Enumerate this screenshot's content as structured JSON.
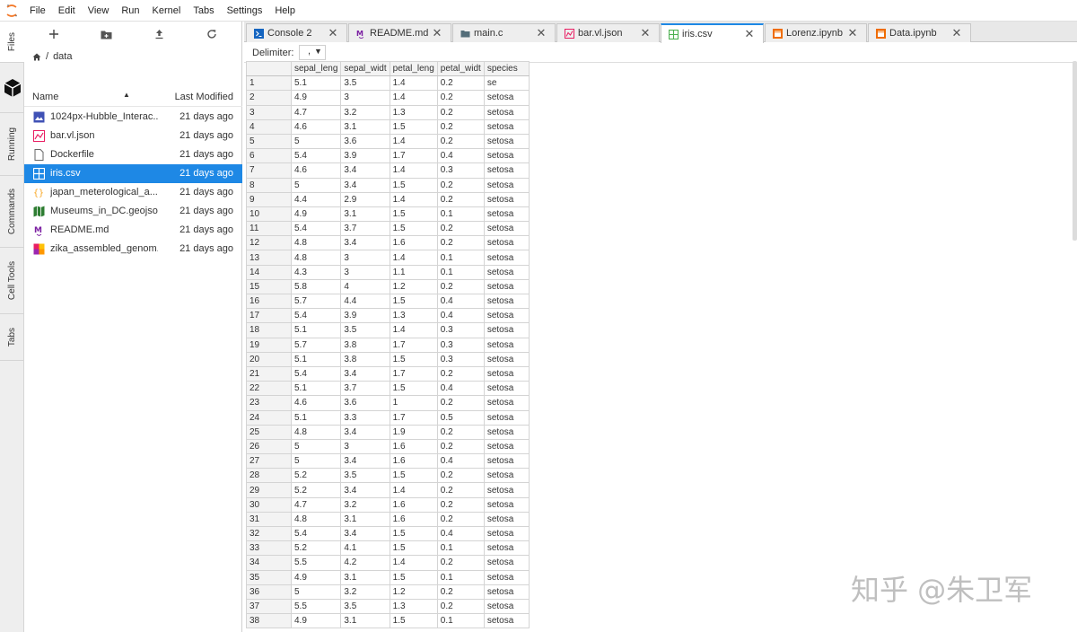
{
  "menubar": {
    "items": [
      "File",
      "Edit",
      "View",
      "Run",
      "Kernel",
      "Tabs",
      "Settings",
      "Help"
    ]
  },
  "sidetabs": {
    "files": "Files",
    "running": "Running",
    "commands": "Commands",
    "cell_tools": "Cell Tools",
    "tabs": "Tabs"
  },
  "filebrowser": {
    "breadcrumb": "data",
    "col_name": "Name",
    "col_modified": "Last Modified",
    "files": [
      {
        "name": "1024px-Hubble_Interac...",
        "modified": "21 days ago",
        "icon": "image-icon"
      },
      {
        "name": "bar.vl.json",
        "modified": "21 days ago",
        "icon": "vega-icon"
      },
      {
        "name": "Dockerfile",
        "modified": "21 days ago",
        "icon": "file-icon"
      },
      {
        "name": "iris.csv",
        "modified": "21 days ago",
        "icon": "spreadsheet-icon"
      },
      {
        "name": "japan_meterological_a...",
        "modified": "21 days ago",
        "icon": "json-icon"
      },
      {
        "name": "Museums_in_DC.geojson",
        "modified": "21 days ago",
        "icon": "map-icon"
      },
      {
        "name": "README.md",
        "modified": "21 days ago",
        "icon": "markdown-icon"
      },
      {
        "name": "zika_assembled_genom...",
        "modified": "21 days ago",
        "icon": "genome-icon"
      }
    ]
  },
  "tabs": [
    {
      "label": "Console 2",
      "icon": "console-icon"
    },
    {
      "label": "README.md",
      "icon": "markdown-icon"
    },
    {
      "label": "main.c",
      "icon": "code-icon"
    },
    {
      "label": "bar.vl.json",
      "icon": "vega-icon"
    },
    {
      "label": "iris.csv",
      "icon": "spreadsheet-icon"
    },
    {
      "label": "Lorenz.ipynb",
      "icon": "notebook-icon"
    },
    {
      "label": "Data.ipynb",
      "icon": "notebook-icon"
    }
  ],
  "delimiter": {
    "label": "Delimiter:",
    "value": ","
  },
  "grid": {
    "headers": [
      "sepal_leng",
      "sepal_widt",
      "petal_leng",
      "petal_widt",
      "species"
    ],
    "rows": [
      [
        "1",
        "5.1",
        "3.5",
        "1.4",
        "0.2",
        "se"
      ],
      [
        "2",
        "4.9",
        "3",
        "1.4",
        "0.2",
        "setosa"
      ],
      [
        "3",
        "4.7",
        "3.2",
        "1.3",
        "0.2",
        "setosa"
      ],
      [
        "4",
        "4.6",
        "3.1",
        "1.5",
        "0.2",
        "setosa"
      ],
      [
        "5",
        "5",
        "3.6",
        "1.4",
        "0.2",
        "setosa"
      ],
      [
        "6",
        "5.4",
        "3.9",
        "1.7",
        "0.4",
        "setosa"
      ],
      [
        "7",
        "4.6",
        "3.4",
        "1.4",
        "0.3",
        "setosa"
      ],
      [
        "8",
        "5",
        "3.4",
        "1.5",
        "0.2",
        "setosa"
      ],
      [
        "9",
        "4.4",
        "2.9",
        "1.4",
        "0.2",
        "setosa"
      ],
      [
        "10",
        "4.9",
        "3.1",
        "1.5",
        "0.1",
        "setosa"
      ],
      [
        "11",
        "5.4",
        "3.7",
        "1.5",
        "0.2",
        "setosa"
      ],
      [
        "12",
        "4.8",
        "3.4",
        "1.6",
        "0.2",
        "setosa"
      ],
      [
        "13",
        "4.8",
        "3",
        "1.4",
        "0.1",
        "setosa"
      ],
      [
        "14",
        "4.3",
        "3",
        "1.1",
        "0.1",
        "setosa"
      ],
      [
        "15",
        "5.8",
        "4",
        "1.2",
        "0.2",
        "setosa"
      ],
      [
        "16",
        "5.7",
        "4.4",
        "1.5",
        "0.4",
        "setosa"
      ],
      [
        "17",
        "5.4",
        "3.9",
        "1.3",
        "0.4",
        "setosa"
      ],
      [
        "18",
        "5.1",
        "3.5",
        "1.4",
        "0.3",
        "setosa"
      ],
      [
        "19",
        "5.7",
        "3.8",
        "1.7",
        "0.3",
        "setosa"
      ],
      [
        "20",
        "5.1",
        "3.8",
        "1.5",
        "0.3",
        "setosa"
      ],
      [
        "21",
        "5.4",
        "3.4",
        "1.7",
        "0.2",
        "setosa"
      ],
      [
        "22",
        "5.1",
        "3.7",
        "1.5",
        "0.4",
        "setosa"
      ],
      [
        "23",
        "4.6",
        "3.6",
        "1",
        "0.2",
        "setosa"
      ],
      [
        "24",
        "5.1",
        "3.3",
        "1.7",
        "0.5",
        "setosa"
      ],
      [
        "25",
        "4.8",
        "3.4",
        "1.9",
        "0.2",
        "setosa"
      ],
      [
        "26",
        "5",
        "3",
        "1.6",
        "0.2",
        "setosa"
      ],
      [
        "27",
        "5",
        "3.4",
        "1.6",
        "0.4",
        "setosa"
      ],
      [
        "28",
        "5.2",
        "3.5",
        "1.5",
        "0.2",
        "setosa"
      ],
      [
        "29",
        "5.2",
        "3.4",
        "1.4",
        "0.2",
        "setosa"
      ],
      [
        "30",
        "4.7",
        "3.2",
        "1.6",
        "0.2",
        "setosa"
      ],
      [
        "31",
        "4.8",
        "3.1",
        "1.6",
        "0.2",
        "setosa"
      ],
      [
        "32",
        "5.4",
        "3.4",
        "1.5",
        "0.4",
        "setosa"
      ],
      [
        "33",
        "5.2",
        "4.1",
        "1.5",
        "0.1",
        "setosa"
      ],
      [
        "34",
        "5.5",
        "4.2",
        "1.4",
        "0.2",
        "setosa"
      ],
      [
        "35",
        "4.9",
        "3.1",
        "1.5",
        "0.1",
        "setosa"
      ],
      [
        "36",
        "5",
        "3.2",
        "1.2",
        "0.2",
        "setosa"
      ],
      [
        "37",
        "5.5",
        "3.5",
        "1.3",
        "0.2",
        "setosa"
      ],
      [
        "38",
        "4.9",
        "3.1",
        "1.5",
        "0.1",
        "setosa"
      ]
    ]
  },
  "watermark": "知乎 @朱卫军",
  "colors": {
    "accent": "#1e88e5",
    "selected_row": "#1e88e5"
  }
}
